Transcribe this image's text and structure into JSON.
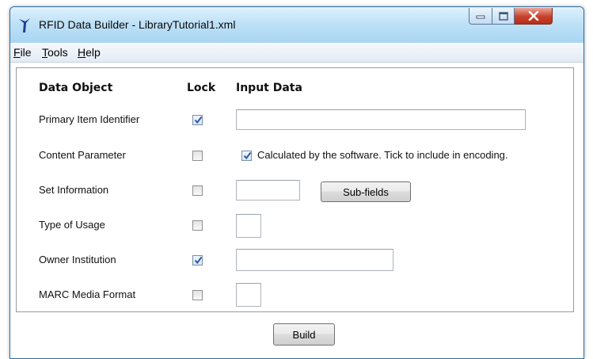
{
  "window": {
    "title": "RFID Data Builder - LibraryTutorial1.xml"
  },
  "menu": {
    "items": [
      {
        "accel": "F",
        "rest": "ile"
      },
      {
        "accel": "T",
        "rest": "ools"
      },
      {
        "accel": "H",
        "rest": "elp"
      }
    ]
  },
  "table": {
    "headers": {
      "object": "Data Object",
      "lock": "Lock",
      "input": "Input Data"
    },
    "rows": [
      {
        "label": "Primary Item Identifier",
        "locked": true,
        "value": ""
      },
      {
        "label": "Content Parameter",
        "locked": false,
        "calc_checked": true,
        "calc_text": "Calculated by the software. Tick to include in encoding."
      },
      {
        "label": "Set Information",
        "locked": false,
        "value": "",
        "button": "Sub-fields"
      },
      {
        "label": "Type of Usage",
        "locked": false,
        "value": ""
      },
      {
        "label": "Owner Institution",
        "locked": true,
        "value": ""
      },
      {
        "label": "MARC Media Format",
        "locked": false,
        "value": ""
      }
    ]
  },
  "build_button": "Build",
  "colors": {
    "title_bar": "#bfe1f7",
    "close_button": "#c8402a",
    "check_mark": "#2a5cab"
  }
}
